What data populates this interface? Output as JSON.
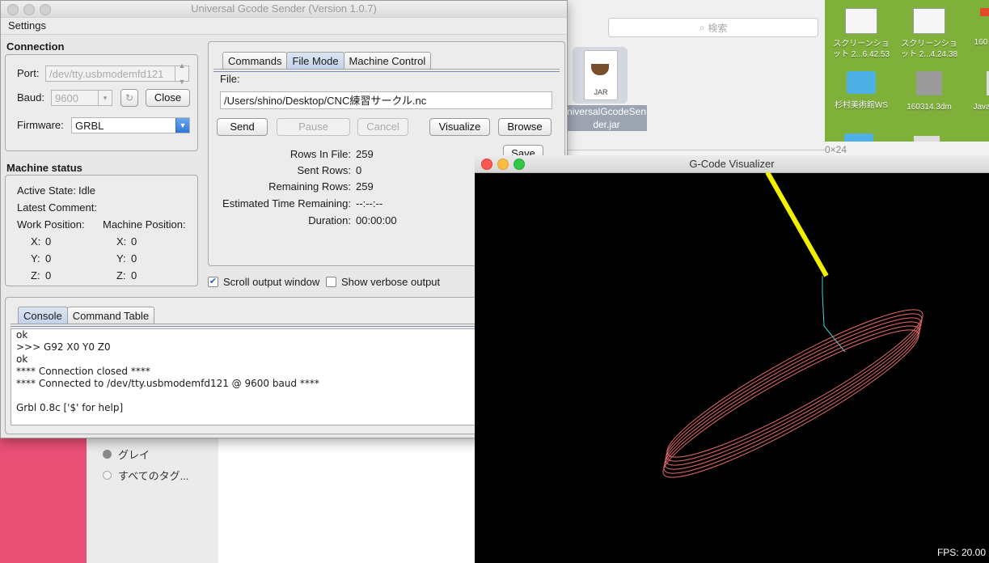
{
  "finder": {
    "search_placeholder": "検索",
    "jar_icon_text": "JAR",
    "jar_label_line1": "niversalGcodeSen",
    "jar_label_line2": "der.jar",
    "dimension_text": "0×24",
    "tags": [
      {
        "label": "グレイ",
        "color": "#8a8a8a"
      },
      {
        "label": "すべてのタグ...",
        "color": "#e0e0e0"
      }
    ]
  },
  "desktop": {
    "icons": [
      {
        "line1": "スクリーンショ",
        "line2": "ット 2...6.42.53"
      },
      {
        "line1": "スクリーンショ",
        "line2": "ット 2...4.24.38"
      },
      {
        "line1": "160",
        "line2": ""
      },
      {
        "line1": "杉村美術館WS",
        "line2": ""
      },
      {
        "line1": "160314.3dm",
        "line2": ""
      },
      {
        "line1": "Java",
        "line2": ""
      }
    ]
  },
  "ugs": {
    "title": "Universal Gcode Sender (Version 1.0.7)",
    "menu": {
      "settings": "Settings"
    },
    "connection": {
      "title": "Connection",
      "port_label": "Port:",
      "port_value": "/dev/tty.usbmodemfd121",
      "baud_label": "Baud:",
      "baud_value": "9600",
      "close_label": "Close",
      "firmware_label": "Firmware:",
      "firmware_value": "GRBL"
    },
    "machine_status": {
      "title": "Machine status",
      "active_state_label": "Active State:",
      "active_state_value": "Idle",
      "latest_comment_label": "Latest Comment:",
      "work_position_label": "Work Position:",
      "machine_position_label": "Machine Position:",
      "work": {
        "x_label": "X:",
        "x": "0",
        "y_label": "Y:",
        "y": "0",
        "z_label": "Z:",
        "z": "0"
      },
      "machine": {
        "x_label": "X:",
        "x": "0",
        "y_label": "Y:",
        "y": "0",
        "z_label": "Z:",
        "z": "0"
      }
    },
    "tabs": [
      "Commands",
      "File Mode",
      "Machine Control"
    ],
    "file_mode": {
      "file_label": "File:",
      "file_path": "/Users/shino/Desktop/CNC練習サークル.nc",
      "send": "Send",
      "pause": "Pause",
      "cancel": "Cancel",
      "visualize": "Visualize",
      "browse": "Browse",
      "save": "Save",
      "rows_in_file_label": "Rows In File:",
      "rows_in_file": "259",
      "sent_rows_label": "Sent Rows:",
      "sent_rows": "0",
      "remaining_rows_label": "Remaining Rows:",
      "remaining_rows": "259",
      "est_time_label": "Estimated Time Remaining:",
      "est_time": "--:--:--",
      "duration_label": "Duration:",
      "duration": "00:00:00"
    },
    "options": {
      "scroll_output": "Scroll output window",
      "scroll_output_checked": true,
      "verbose_output": "Show verbose output",
      "verbose_output_checked": false
    },
    "console_tabs": [
      "Console",
      "Command Table"
    ],
    "console_lines": [
      "ok",
      ">>> G92 X0 Y0 Z0",
      "ok",
      "**** Connection closed ****",
      "**** Connected to /dev/tty.usbmodemfd121 @ 9600 baud ****",
      "",
      "Grbl 0.8c ['$' for help]"
    ]
  },
  "visualizer": {
    "title": "G-Code Visualizer",
    "fps": "FPS: 20.00",
    "colors": {
      "tool": "#f0f000",
      "rapid": "#3fd0d8",
      "path": "#e86a6a",
      "background": "#000000"
    }
  }
}
